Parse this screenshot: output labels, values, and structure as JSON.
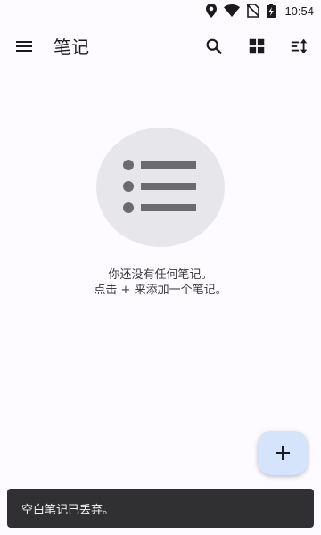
{
  "status_bar": {
    "time": "10:54",
    "icons": [
      "location-icon",
      "wifi-icon",
      "no-sim-icon",
      "battery-charging-icon"
    ]
  },
  "app_bar": {
    "title": "笔记",
    "actions": [
      "menu-icon",
      "search-icon",
      "grid-view-icon",
      "sort-icon"
    ]
  },
  "empty_state": {
    "icon": "list-icon",
    "line1": "你还没有任何笔记。",
    "line2": "点击 + 来添加一个笔记。"
  },
  "fab": {
    "label": "+"
  },
  "snackbar": {
    "message": "空白笔记已丢弃。"
  },
  "colors": {
    "background": "#fdfbff",
    "fab": "#d6e4fb",
    "snackbar": "#303033",
    "empty_circle": "#e7e6ea",
    "icon_gray": "#6b6b6f"
  }
}
